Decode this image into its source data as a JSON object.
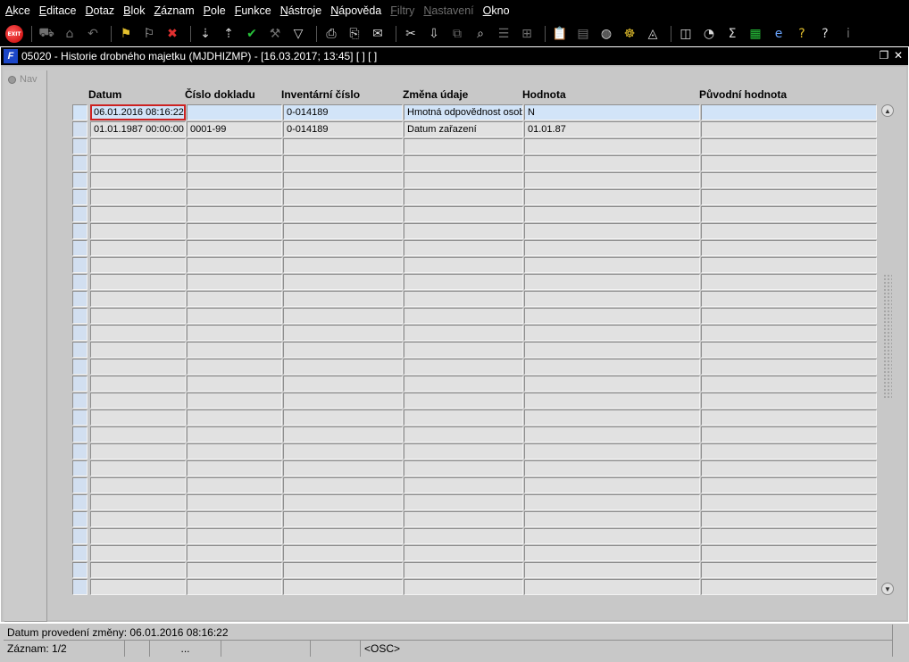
{
  "menu": [
    {
      "label": "Akce",
      "u": "A",
      "rest": "kce",
      "disabled": false
    },
    {
      "label": "Editace",
      "u": "E",
      "rest": "ditace",
      "disabled": false
    },
    {
      "label": "Dotaz",
      "u": "D",
      "rest": "otaz",
      "disabled": false
    },
    {
      "label": "Blok",
      "u": "B",
      "rest": "lok",
      "disabled": false
    },
    {
      "label": "Záznam",
      "u": "Z",
      "rest": "áznam",
      "disabled": false
    },
    {
      "label": "Pole",
      "u": "P",
      "rest": "ole",
      "disabled": false
    },
    {
      "label": "Funkce",
      "u": "F",
      "rest": "unkce",
      "disabled": false
    },
    {
      "label": "Nástroje",
      "u": "N",
      "rest": "ástroje",
      "disabled": false
    },
    {
      "label": "Nápověda",
      "u": "N",
      "rest": "ápověda",
      "disabled": false
    },
    {
      "label": "Filtry",
      "u": "F",
      "rest": "iltry",
      "disabled": true
    },
    {
      "label": "Nastavení",
      "u": "N",
      "rest": "astavení",
      "disabled": true
    },
    {
      "label": "Okno",
      "u": "O",
      "rest": "kno",
      "disabled": false
    }
  ],
  "toolbar": [
    {
      "icon": "exit-icon",
      "glyph": "EXIT",
      "cls": "exit"
    },
    {
      "sep": true
    },
    {
      "icon": "save-icon",
      "glyph": "⛟",
      "cls": "dim"
    },
    {
      "icon": "print-preview-icon",
      "glyph": "⌂",
      "cls": "dim"
    },
    {
      "icon": "undo-icon",
      "glyph": "↶",
      "cls": "dim"
    },
    {
      "sep": true
    },
    {
      "icon": "query-enter-icon",
      "glyph": "⚑",
      "cls": "yellow"
    },
    {
      "icon": "query-execute-icon",
      "glyph": "⚐",
      "cls": ""
    },
    {
      "icon": "query-cancel-icon",
      "glyph": "✖",
      "cls": "red"
    },
    {
      "sep": true
    },
    {
      "icon": "sort-ascending-icon",
      "glyph": "⇣",
      "cls": ""
    },
    {
      "icon": "sort-descending-icon",
      "glyph": "⇡",
      "cls": ""
    },
    {
      "icon": "confirm-check-icon",
      "glyph": "✔",
      "cls": "green"
    },
    {
      "icon": "tools-icon",
      "glyph": "⚒",
      "cls": "dim"
    },
    {
      "icon": "filter-icon",
      "glyph": "▽",
      "cls": ""
    },
    {
      "sep": true
    },
    {
      "icon": "print-icon",
      "glyph": "⎙",
      "cls": ""
    },
    {
      "icon": "print-setup-icon",
      "glyph": "⎘",
      "cls": ""
    },
    {
      "icon": "mail-icon",
      "glyph": "✉",
      "cls": ""
    },
    {
      "sep": true
    },
    {
      "icon": "cut-icon",
      "glyph": "✂",
      "cls": ""
    },
    {
      "icon": "paste-icon",
      "glyph": "⇩",
      "cls": ""
    },
    {
      "icon": "copy-icon",
      "glyph": "⧉",
      "cls": "dim"
    },
    {
      "icon": "find-icon",
      "glyph": "⌕",
      "cls": ""
    },
    {
      "icon": "list-icon",
      "glyph": "☰",
      "cls": "dim"
    },
    {
      "icon": "tree-icon",
      "glyph": "⊞",
      "cls": "dim"
    },
    {
      "sep": true
    },
    {
      "icon": "clipboard-icon",
      "glyph": "📋",
      "cls": ""
    },
    {
      "icon": "document-icon",
      "glyph": "▤",
      "cls": "dim"
    },
    {
      "icon": "globe-icon",
      "glyph": "◍",
      "cls": ""
    },
    {
      "icon": "wheel-icon",
      "glyph": "☸",
      "cls": "yellow"
    },
    {
      "icon": "triangle-icon",
      "glyph": "◬",
      "cls": ""
    },
    {
      "sep": true
    },
    {
      "icon": "chart-icon",
      "glyph": "◫",
      "cls": ""
    },
    {
      "icon": "calendar-icon",
      "glyph": "◔",
      "cls": ""
    },
    {
      "icon": "sum-icon",
      "glyph": "Σ",
      "cls": ""
    },
    {
      "icon": "excel-icon",
      "glyph": "▦",
      "cls": "green"
    },
    {
      "icon": "internet-explorer-icon",
      "glyph": "e",
      "cls": "blue"
    },
    {
      "icon": "help-icon",
      "glyph": "?",
      "cls": "yellow"
    },
    {
      "icon": "help-context-icon",
      "glyph": "?",
      "cls": ""
    },
    {
      "icon": "info-icon",
      "glyph": "i",
      "cls": "dim"
    }
  ],
  "window": {
    "icon_glyph": "F",
    "title": "05020 - Historie drobného majetku (MJDHIZMP) - [16.03.2017; 13:45]  [ ]  [ ]",
    "restore_glyph": "❐",
    "close_glyph": "✕"
  },
  "nav": {
    "label": "Nav"
  },
  "columns": [
    "Datum",
    "Číslo dokladu",
    "Inventární číslo",
    "Změna údaje",
    "Hodnota",
    "Původní hodnota"
  ],
  "rows": [
    [
      "06.01.2016 08:16:22",
      "",
      "0-014189",
      "Hmotná odpovědnost osob",
      "N",
      ""
    ],
    [
      "01.01.1987 00:00:00",
      "0001-99",
      "0-014189",
      "Datum zařazení",
      "01.01.87",
      ""
    ]
  ],
  "empty_rows": 27,
  "scroll": {
    "up_glyph": "▲",
    "down_glyph": "▼"
  },
  "status": {
    "message": "Datum provedení změny: 06.01.2016 08:16:22",
    "record": "Záznam: 1/2",
    "seg3": "...",
    "mode": "<OSC>"
  }
}
